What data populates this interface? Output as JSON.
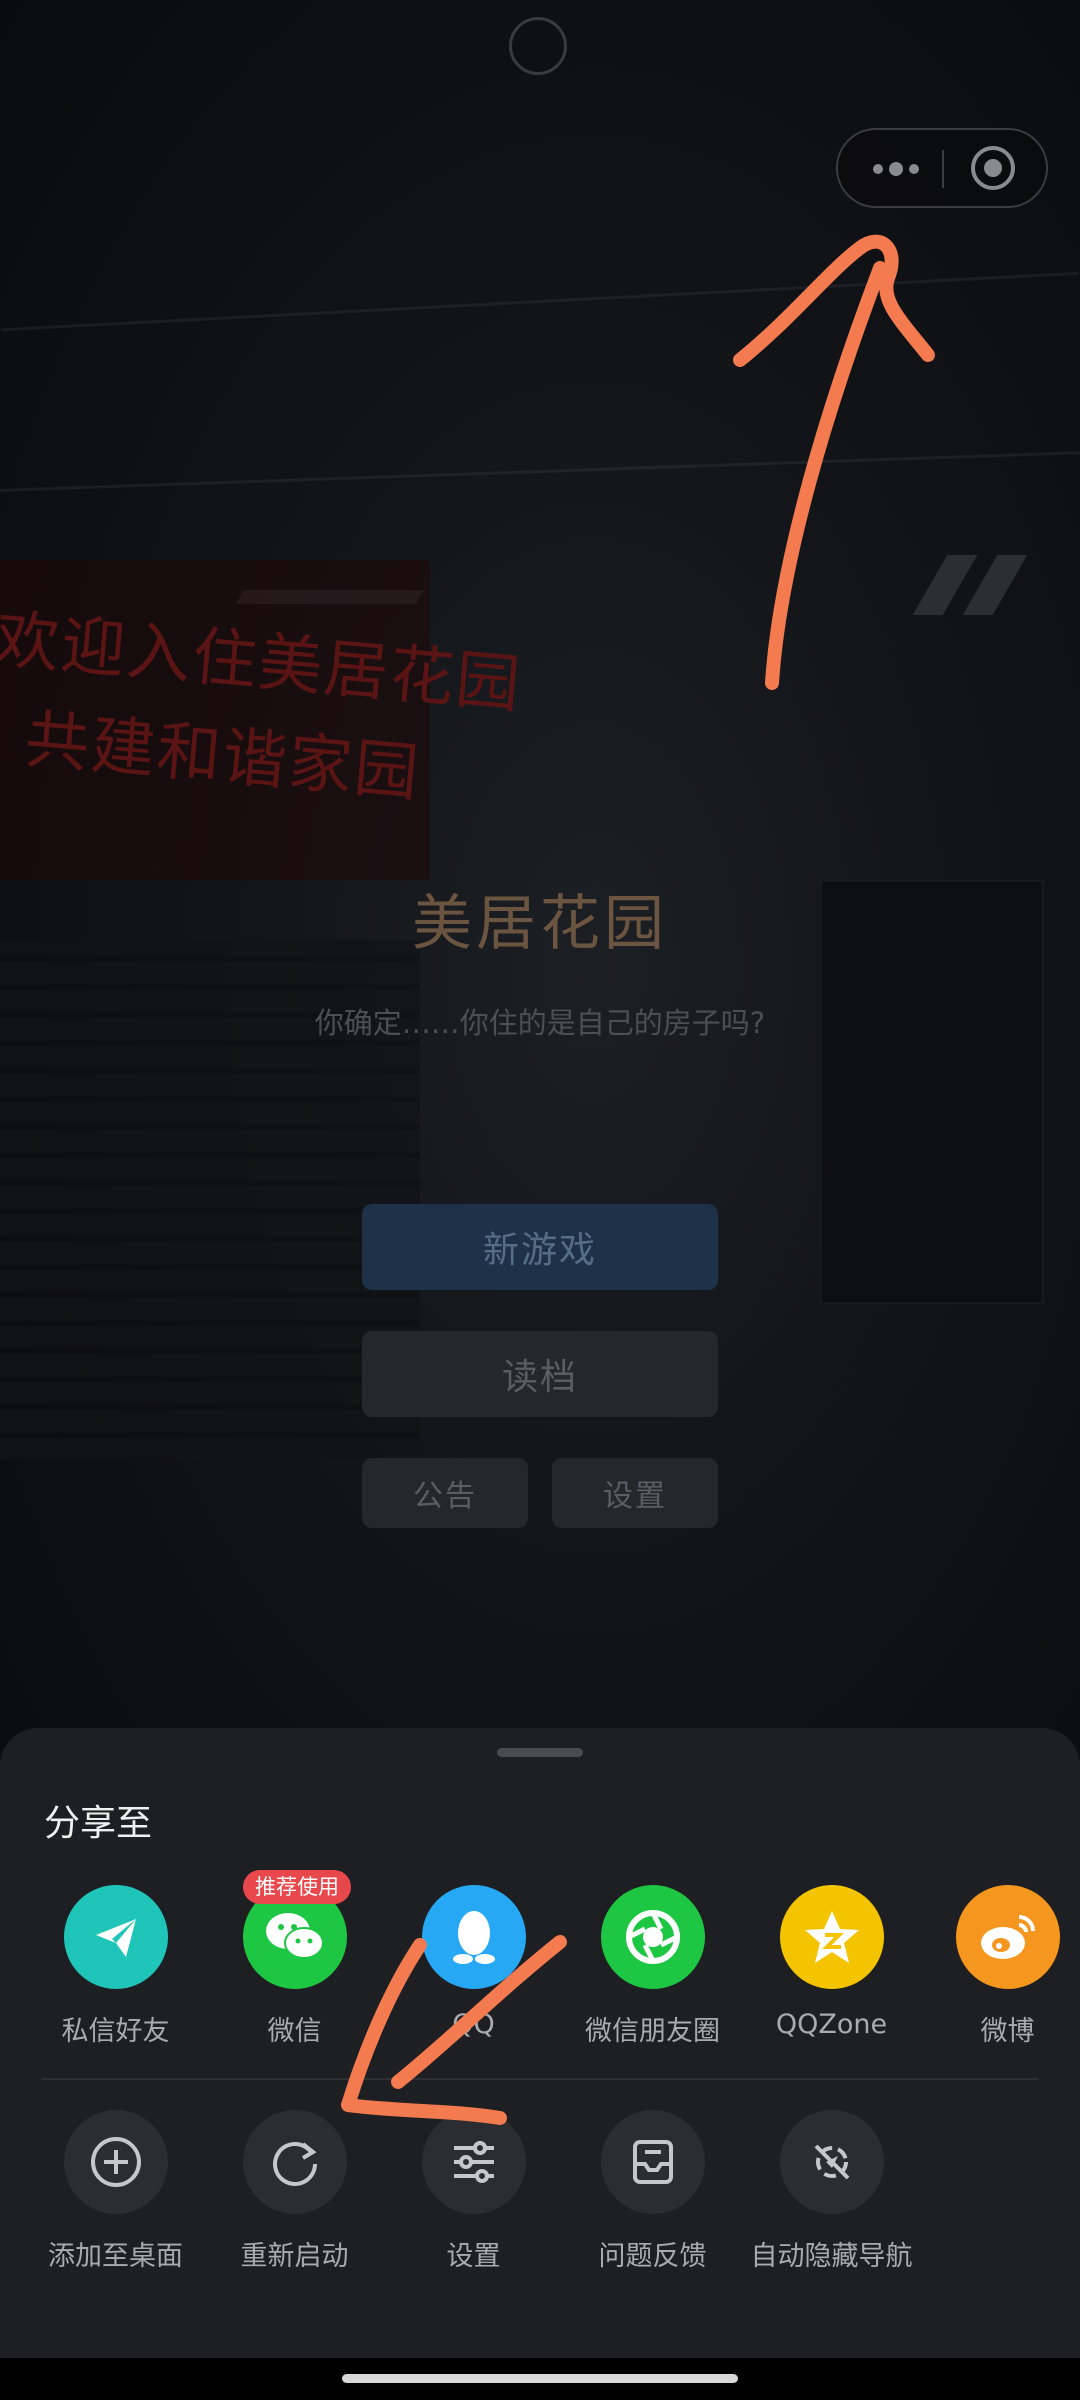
{
  "game": {
    "title": "美居花园",
    "subtitle": "你确定……你住的是自己的房子吗?",
    "banner_line1": "欢迎入住美居花园",
    "banner_line2": "共建和谐家园",
    "new_game": "新游戏",
    "load_game": "读档",
    "notice": "公告",
    "settings": "设置"
  },
  "share_sheet": {
    "title": "分享至",
    "badge": "推荐使用",
    "share_items": [
      {
        "label": "私信好友",
        "icon": "paper-plane-icon",
        "color": "#1ec5b8"
      },
      {
        "label": "微信",
        "icon": "wechat-icon",
        "color": "#1ec743"
      },
      {
        "label": "QQ",
        "icon": "qq-penguin-icon",
        "color": "#26a8f5"
      },
      {
        "label": "微信朋友圈",
        "icon": "moments-shutter-icon",
        "color": "#1ec743"
      },
      {
        "label": "QQZone",
        "icon": "qzone-star-icon",
        "color": "#f5c400"
      },
      {
        "label": "微博",
        "icon": "weibo-icon",
        "color": "#f5961e"
      }
    ],
    "action_items": [
      {
        "label": "添加至桌面",
        "icon": "add-circle-icon"
      },
      {
        "label": "重新启动",
        "icon": "restart-icon"
      },
      {
        "label": "设置",
        "icon": "sliders-icon"
      },
      {
        "label": "问题反馈",
        "icon": "feedback-inbox-icon"
      },
      {
        "label": "自动隐藏导航",
        "icon": "hide-navigation-icon"
      }
    ]
  },
  "colors": {
    "annotation": "#f47b4f",
    "sheet_background": "#1e1f22"
  }
}
